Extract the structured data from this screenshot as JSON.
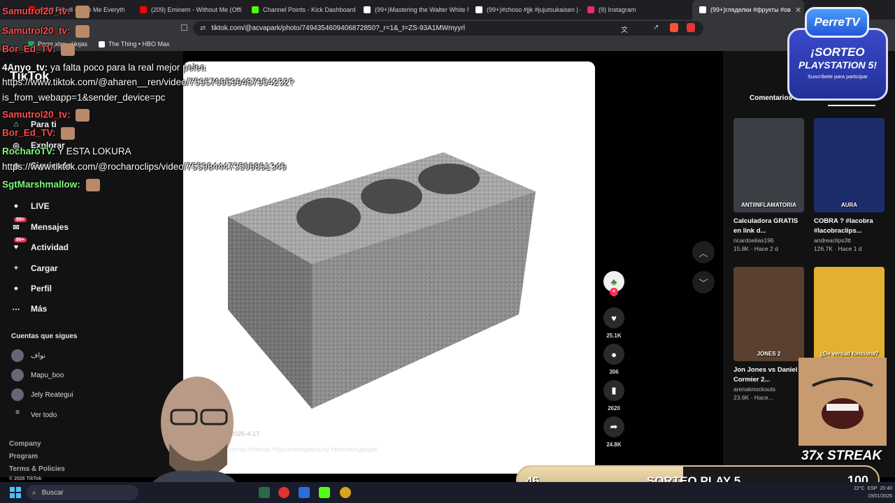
{
  "tabs": [
    {
      "label": "(209) Pitbull - Give Me Everyth",
      "color": "#ff0000"
    },
    {
      "label": "(209) Eminem - Without Me (Offi",
      "color": "#ff0000"
    },
    {
      "label": "Channel Points - Kick Dashboard",
      "color": "#53fc18"
    },
    {
      "label": "(99+)Mastering the Walter White M",
      "color": "#ffffff"
    },
    {
      "label": "(99+)#choso #jjk #jujutsukaisen | ch",
      "color": "#ffffff"
    },
    {
      "label": "(9) Instagram",
      "color": "#e1306c"
    },
    {
      "label": "(99+)гляделки #фрукты #ов",
      "color": "#ffffff"
    }
  ],
  "address": {
    "url": "tiktok.com/@acvapark/photo/7494354609406872850?_r=1&_t=ZS-93A1MWmyyrl"
  },
  "bookmarks": [
    {
      "label": "Perre.xlsx - Hojas",
      "color": "#21a366"
    },
    {
      "label": "The Thing • HBO Max",
      "color": "#ffffff"
    }
  ],
  "sidebar": {
    "logo": "TikTok",
    "nav": [
      {
        "label": "Para ti",
        "icon": "home-icon",
        "glyph": "⌂"
      },
      {
        "label": "Explorar",
        "icon": "compass-icon",
        "glyph": "◎"
      },
      {
        "label": "Siguiendo",
        "icon": "following-icon",
        "glyph": "◉"
      },
      {
        "label": "LIVE",
        "icon": "live-icon",
        "glyph": "●"
      },
      {
        "label": "Mensajes",
        "icon": "messages-icon",
        "glyph": "✉",
        "badge": "99+"
      },
      {
        "label": "Actividad",
        "icon": "activity-icon",
        "glyph": "♥",
        "badge": "99+"
      },
      {
        "label": "Cargar",
        "icon": "upload-icon",
        "glyph": "+"
      },
      {
        "label": "Perfil",
        "icon": "profile-icon",
        "glyph": "●"
      },
      {
        "label": "Más",
        "icon": "more-icon",
        "glyph": "⋯"
      }
    ],
    "following_header": "Cuentas que sigues",
    "following": [
      "نواف",
      "Mapu_boo",
      "Jely Reategui",
      "Ver todo"
    ],
    "footer": [
      "Company",
      "Program",
      "Terms & Policies",
      "© 2026 TikTok"
    ]
  },
  "post": {
    "caption": "#фрукты #овощи #фруктыподмузыку #рекомендации",
    "date": "2025-4-17"
  },
  "actions": {
    "likes": "25.1K",
    "comments": "306",
    "saves": "2620",
    "shares": "24.8K"
  },
  "right_panel": {
    "tab_label": "Comentarios",
    "cards": [
      {
        "title": "Calculadora GRATIS en link d...",
        "author": "ricardoelias196",
        "views": "15.8K",
        "age": "Hace 2 d",
        "thumb_text": "ANTIINFLAMATORIA",
        "bg": "#3b3e44"
      },
      {
        "title": "COBRA ? #lacobra #lacobraclips...",
        "author": "andreaclips3tt",
        "views": "126.7K",
        "age": "Hace 1 d",
        "thumb_text": "AURA",
        "bg": "#1d2c6b"
      },
      {
        "title": "Jon Jones vs Daniel Cormier 2...",
        "author": "arenaknockouts",
        "views": "23.6K",
        "age": "Hace...",
        "thumb_text": "JONES 2",
        "bg": "#5a4030"
      },
      {
        "title": "",
        "author": "",
        "views": "",
        "age": "",
        "thumb_text": "¿De verdad funciona?",
        "bg": "#e3b030"
      }
    ]
  },
  "chat": [
    {
      "user": "Samutrol20_tv:",
      "text": "",
      "color": "#ff4d4d",
      "emote": true
    },
    {
      "user": "Samutrol20_tv:",
      "text": "",
      "color": "#ff4d4d",
      "emote": true
    },
    {
      "user": "Bor_Ed_TV:",
      "text": "",
      "color": "#ff4d4d",
      "emote": true
    },
    {
      "user": "4Anyo_tv:",
      "text": "ya falta poco para la real mejor pelea",
      "color": "#ffffff",
      "emote": false
    },
    {
      "user": "",
      "text": "https://www.tiktok.com/@aharen__ren/video/7595709599487954232?",
      "color": "#ffffff",
      "emote": false
    },
    {
      "user": "",
      "text": "is_from_webapp=1&sender_device=pc",
      "color": "#ffffff",
      "emote": false
    },
    {
      "user": "Samutrol20_tv:",
      "text": "",
      "color": "#ff4d4d",
      "emote": true
    },
    {
      "user": "Bor_Ed_TV:",
      "text": "",
      "color": "#ff4d4d",
      "emote": true
    },
    {
      "user": "RocharoTV:",
      "text": "Y ESTA LOKURA",
      "color": "#7cff7c",
      "emote": false
    },
    {
      "user": "",
      "text": "https://www.tiktok.com/@rocharoclips/video/7559844473509891349",
      "color": "#ffffff",
      "emote": false
    },
    {
      "user": "SgtMarshmallow:",
      "text": "",
      "color": "#7cff7c",
      "emote": true
    }
  ],
  "giveaway": {
    "brand": "PerreTV",
    "line1": "¡SORTEO",
    "line2": "PLAYSTATION 5!",
    "line3": "Suscríbete para participar"
  },
  "goal_bar": {
    "current": "46",
    "label": "SORTEO PLAY 5",
    "target": "100",
    "progress": 0.46
  },
  "streak": "37x STREAK",
  "taskbar": {
    "search_placeholder": "Buscar",
    "weather": "22°C",
    "lang": "ESP",
    "time": "20:40",
    "date": "19/01/2026"
  }
}
